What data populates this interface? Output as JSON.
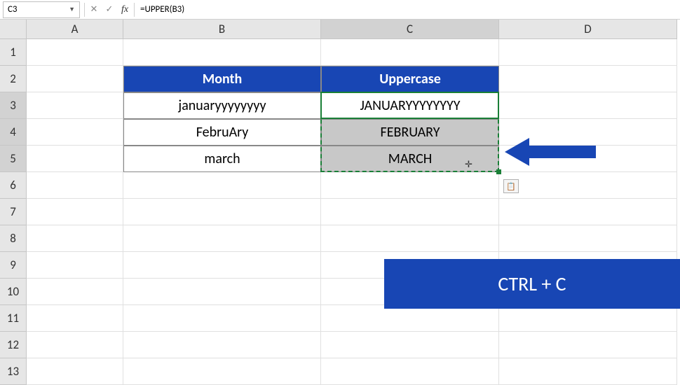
{
  "formula_bar": {
    "name_box": "C3",
    "formula": "=UPPER(B3)"
  },
  "columns": [
    "A",
    "B",
    "C",
    "D"
  ],
  "rows": [
    "1",
    "2",
    "3",
    "4",
    "5",
    "6",
    "7",
    "8",
    "9",
    "10",
    "11",
    "12",
    "13"
  ],
  "table": {
    "headers": {
      "b": "Month",
      "c": "Uppercase"
    },
    "r3": {
      "b": "januaryyyyyyyy",
      "c": "JANUARYYYYYYYY"
    },
    "r4": {
      "b": "FebruAry",
      "c": "FEBRUARY"
    },
    "r5": {
      "b": "march",
      "c": "MARCH"
    }
  },
  "callout": {
    "text": "CTRL + C"
  },
  "icons": {
    "dropdown": "▼",
    "cancel": "✕",
    "enter": "✓",
    "fx": "fx",
    "paste": "📋"
  },
  "chart_data": {
    "type": "table",
    "title": "",
    "columns": [
      "Month",
      "Uppercase"
    ],
    "rows": [
      [
        "januaryyyyyyyy",
        "JANUARYYYYYYYY"
      ],
      [
        "FebruAry",
        "FEBRUARY"
      ],
      [
        "march",
        "MARCH"
      ]
    ]
  }
}
